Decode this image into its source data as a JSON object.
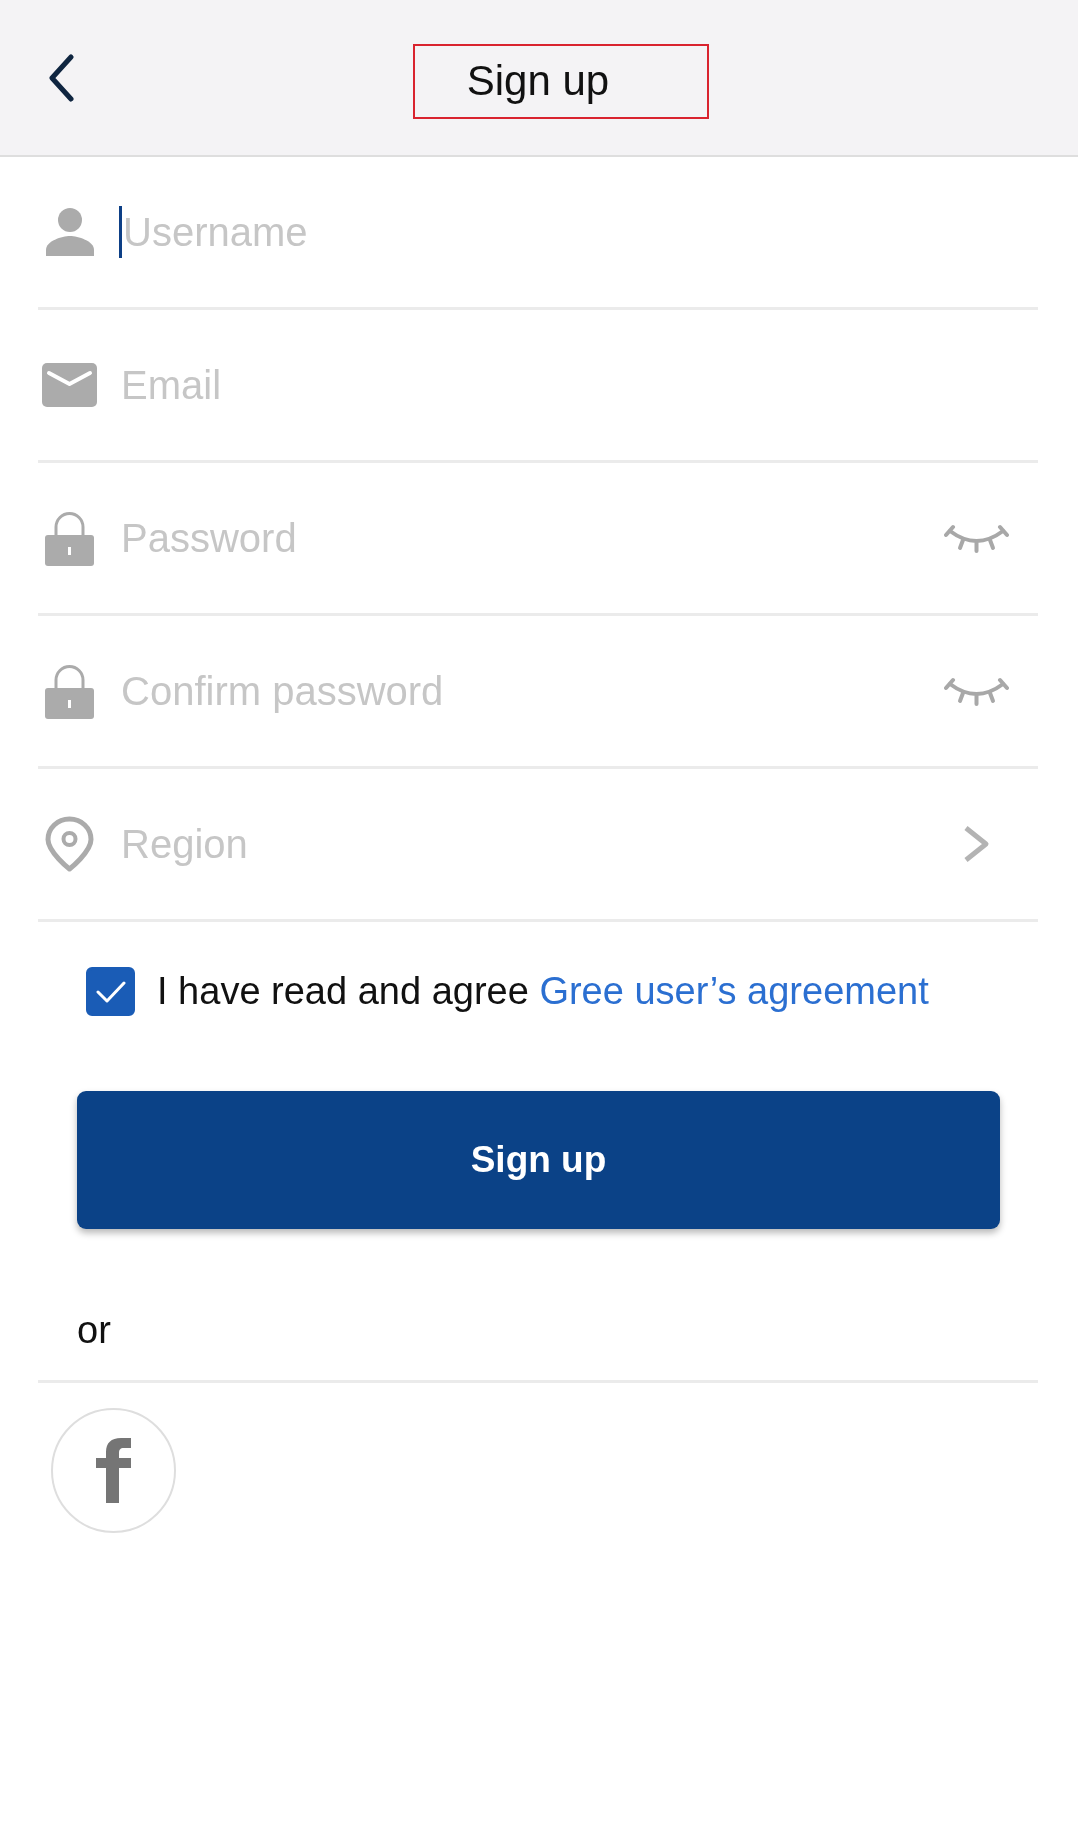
{
  "header": {
    "title": "Sign up",
    "highlighted": true
  },
  "fields": [
    {
      "kind": "text",
      "placeholder": "Username",
      "focused": true
    },
    {
      "kind": "email",
      "placeholder": "Email",
      "focused": false
    },
    {
      "kind": "password",
      "placeholder": "Password",
      "focused": false
    },
    {
      "kind": "password",
      "placeholder": "Confirm password",
      "focused": false
    },
    {
      "kind": "select",
      "placeholder": "Region",
      "focused": false
    }
  ],
  "agreement": {
    "checked": true,
    "text": "I have read and agree",
    "link": "Gree user’s agreement"
  },
  "submit_button": {
    "label": "Sign up"
  },
  "separator": {
    "label": "or"
  },
  "social_logins": [
    {
      "kind": "facebook"
    }
  ]
}
